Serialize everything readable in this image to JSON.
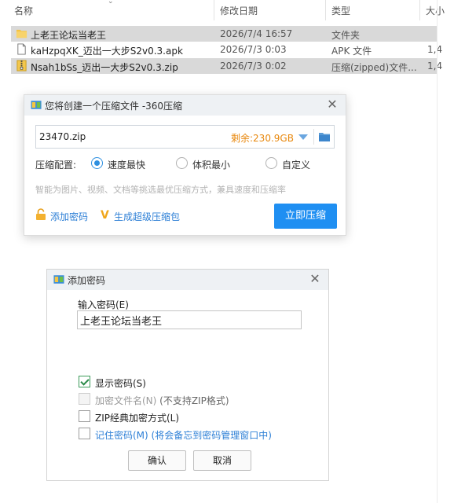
{
  "explorer": {
    "headers": {
      "name": "名称",
      "modified": "修改日期",
      "type": "类型",
      "size": "大小"
    },
    "rows": [
      {
        "name": "上老王论坛当老王",
        "modified": "2026/7/4 16:57",
        "type": "文件夹",
        "size": "",
        "icon": "folder-icon",
        "selected": true
      },
      {
        "name": "kaHzpqXK_迈出一大步S2v0.3.apk",
        "modified": "2026/7/3 0:03",
        "type": "APK 文件",
        "size": "1,4",
        "icon": "file-icon",
        "selected": false
      },
      {
        "name": "Nsah1bSs_迈出一大步S2v0.3.zip",
        "modified": "2026/7/3 0:02",
        "type": "压缩(zipped)文件...",
        "size": "1,4",
        "icon": "zip-icon",
        "selected": true
      }
    ]
  },
  "compress": {
    "title": "您将创建一个压缩文件 -360压缩",
    "filename": "23470.zip",
    "free_space": "剩余:230.9GB",
    "config_label": "压缩配置:",
    "options": [
      {
        "label": "速度最快",
        "checked": true
      },
      {
        "label": "体积最小",
        "checked": false
      },
      {
        "label": "自定义",
        "checked": false
      }
    ],
    "hint": "智能为图片、视频、文档等挑选最优压缩方式，兼具速度和压缩率",
    "add_password": "添加密码",
    "super_pack": "生成超级压缩包",
    "compress_now": "立即压缩"
  },
  "password": {
    "title": "添加密码",
    "input_label": "输入密码(E)",
    "input_value": "上老王论坛当老王",
    "options": [
      {
        "label": "显示密码(S)",
        "extra": "",
        "checked": true,
        "disabled": false,
        "blue": false
      },
      {
        "label": "加密文件名(N)",
        "extra": " (不支持ZIP格式)",
        "checked": false,
        "disabled": true,
        "blue": false
      },
      {
        "label": "ZIP经典加密方式(L)",
        "extra": "",
        "checked": false,
        "disabled": false,
        "blue": false
      },
      {
        "label": "记住密码(M)",
        "extra": " (将会备忘到密码管理窗口中)",
        "checked": false,
        "disabled": false,
        "blue": true
      }
    ],
    "ok": "确认",
    "cancel": "取消"
  },
  "colors": {
    "accent": "#1f8ff2",
    "free_space": "#e8870c",
    "link": "#2d7fd6",
    "selection": "#d9d9d9"
  }
}
